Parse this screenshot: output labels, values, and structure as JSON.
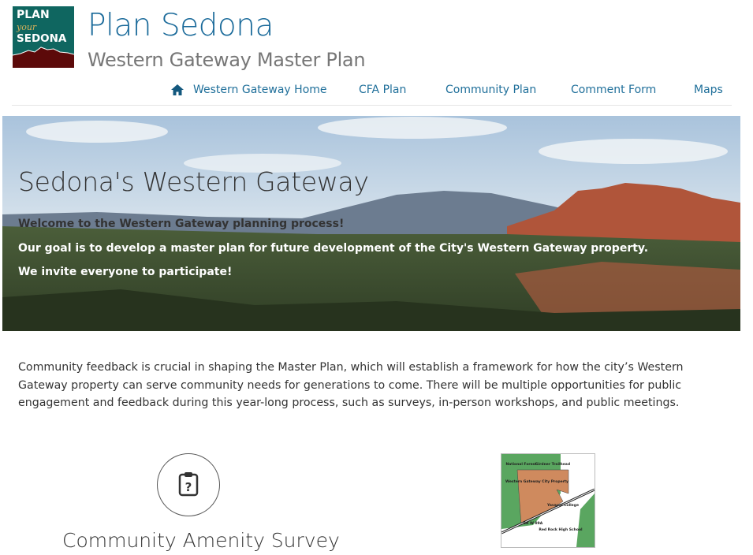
{
  "logo": {
    "line1": "PLAN",
    "line2": "your",
    "line3": "SEDONA",
    "colors": {
      "bg": "#0f6660",
      "mountain": "#5c0a0a"
    }
  },
  "header": {
    "title": "Plan Sedona",
    "subtitle": "Western Gateway Master Plan"
  },
  "nav": {
    "items": [
      {
        "label": "Western Gateway Home",
        "icon": "home-icon"
      },
      {
        "label": "CFA Plan"
      },
      {
        "label": "Community Plan"
      },
      {
        "label": "Comment Form"
      },
      {
        "label": "Maps"
      }
    ]
  },
  "hero": {
    "title": "Sedona's Western Gateway",
    "lines": [
      "Welcome to the Western Gateway planning process!",
      "Our goal is to develop a master plan for future development of the City's Western Gateway property.",
      "We invite everyone to participate!"
    ]
  },
  "intro": "Community feedback is crucial in shaping the Master Plan, which will establish a framework for how the city’s Western Gateway property can serve community needs for generations to come. There will be multiple opportunities for public engagement and feedback during this year-long process, such as surveys, in-person workshops, and public meetings.",
  "survey": {
    "title": "Community Amenity Survey",
    "icon": "clipboard-question-icon"
  },
  "map": {
    "labels": [
      "National Forest",
      "Girdner Trailhead",
      "Western Gateway City Property",
      "Yavapai College",
      "SR W 89A",
      "Red Rock High School"
    ]
  },
  "colors": {
    "link": "#1f6f9a",
    "title": "#1a6a9a"
  }
}
